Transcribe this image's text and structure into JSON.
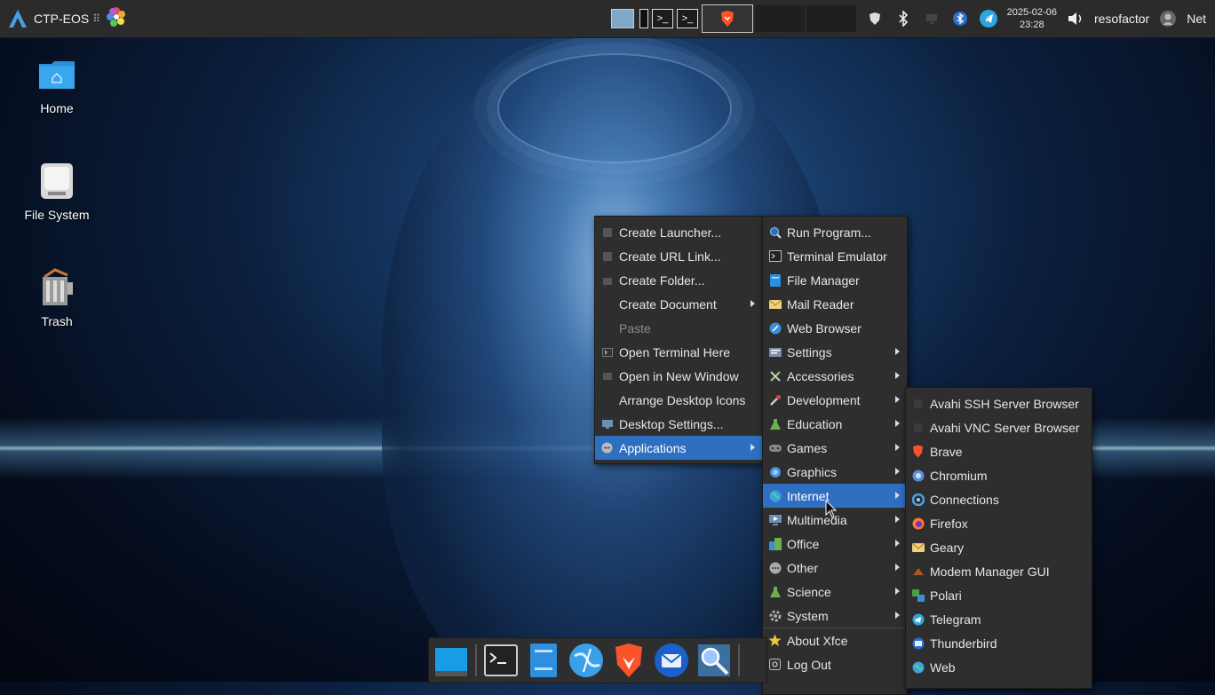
{
  "panel": {
    "title": "CTP-EOS",
    "handle": "⠿",
    "clock_date": "2025-02-06",
    "clock_time": "23:28",
    "user": "resofactor",
    "net": "Net",
    "task_terminal_glyph": ">_"
  },
  "desktop": {
    "icons": [
      {
        "label": "Home"
      },
      {
        "label": "File System"
      },
      {
        "label": "Trash"
      }
    ]
  },
  "context_menu": {
    "items": [
      {
        "label": "Create Launcher...",
        "icon": "launcher-icon"
      },
      {
        "label": "Create URL Link...",
        "icon": "link-icon"
      },
      {
        "label": "Create Folder...",
        "icon": "folder-icon"
      },
      {
        "label": "Create Document",
        "icon": "document-icon",
        "submenu": true
      },
      {
        "label": "Paste",
        "icon": "paste-icon",
        "disabled": true
      },
      {
        "label": "Open Terminal Here",
        "icon": "terminal-icon"
      },
      {
        "label": "Open in New Window",
        "icon": "window-icon"
      },
      {
        "label": "Arrange Desktop Icons",
        "icon": "arrange-icon"
      },
      {
        "label": "Desktop Settings...",
        "icon": "desktop-settings-icon"
      },
      {
        "label": "Applications",
        "icon": "applications-icon",
        "submenu": true,
        "highlight": true
      }
    ]
  },
  "apps_menu": {
    "items": [
      {
        "label": "Run Program...",
        "icon": "run-icon"
      },
      {
        "label": "Terminal Emulator",
        "icon": "terminal-icon"
      },
      {
        "label": "File Manager",
        "icon": "file-manager-icon"
      },
      {
        "label": "Mail Reader",
        "icon": "mail-icon"
      },
      {
        "label": "Web Browser",
        "icon": "web-browser-icon"
      },
      {
        "label": "Settings",
        "icon": "settings-icon",
        "submenu": true
      },
      {
        "label": "Accessories",
        "icon": "accessories-icon",
        "submenu": true
      },
      {
        "label": "Development",
        "icon": "development-icon",
        "submenu": true
      },
      {
        "label": "Education",
        "icon": "education-icon",
        "submenu": true
      },
      {
        "label": "Games",
        "icon": "games-icon",
        "submenu": true
      },
      {
        "label": "Graphics",
        "icon": "graphics-icon",
        "submenu": true
      },
      {
        "label": "Internet",
        "icon": "internet-icon",
        "submenu": true,
        "highlight": true
      },
      {
        "label": "Multimedia",
        "icon": "multimedia-icon",
        "submenu": true
      },
      {
        "label": "Office",
        "icon": "office-icon",
        "submenu": true
      },
      {
        "label": "Other",
        "icon": "other-icon",
        "submenu": true
      },
      {
        "label": "Science",
        "icon": "science-icon",
        "submenu": true
      },
      {
        "label": "System",
        "icon": "system-icon",
        "submenu": true
      },
      {
        "label": "About Xfce",
        "icon": "star-icon"
      },
      {
        "label": "Log Out",
        "icon": "logout-icon"
      }
    ]
  },
  "internet_menu": {
    "items": [
      {
        "label": "Avahi SSH Server Browser",
        "icon": "avahi-icon"
      },
      {
        "label": "Avahi VNC Server Browser",
        "icon": "avahi-icon"
      },
      {
        "label": "Brave",
        "icon": "brave-icon"
      },
      {
        "label": "Chromium",
        "icon": "chromium-icon"
      },
      {
        "label": "Connections",
        "icon": "connections-icon"
      },
      {
        "label": "Firefox",
        "icon": "firefox-icon"
      },
      {
        "label": "Geary",
        "icon": "geary-icon"
      },
      {
        "label": "Modem Manager GUI",
        "icon": "modem-icon"
      },
      {
        "label": "Polari",
        "icon": "polari-icon"
      },
      {
        "label": "Telegram",
        "icon": "telegram-icon"
      },
      {
        "label": "Thunderbird",
        "icon": "thunderbird-icon"
      },
      {
        "label": "Web",
        "icon": "web-icon"
      }
    ]
  },
  "colors": {
    "menu_bg": "#2e2e2e",
    "highlight": "#2f6fc1",
    "panel_bg": "#2b2b2b"
  }
}
